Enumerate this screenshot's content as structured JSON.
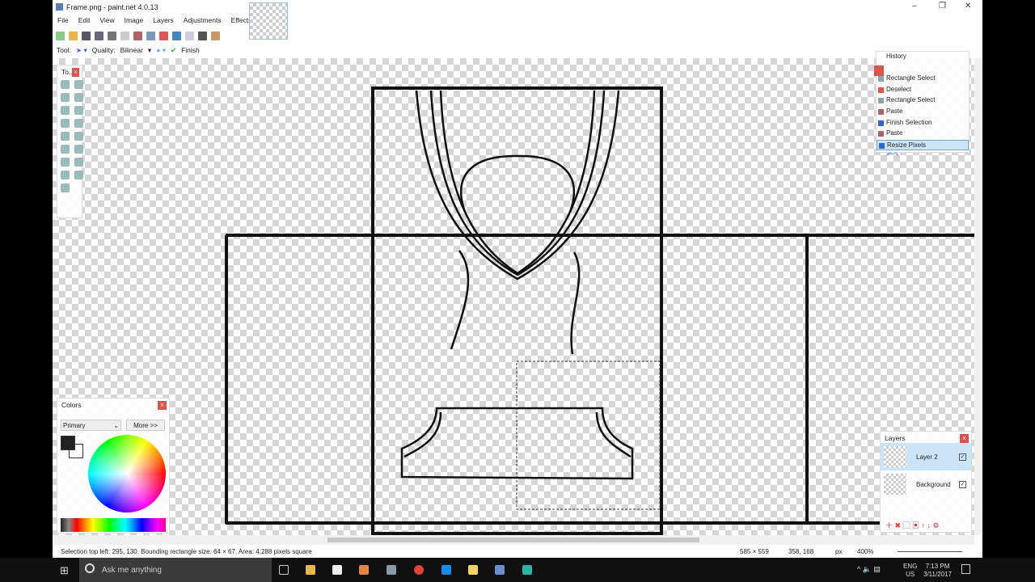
{
  "window": {
    "title": "Frame.png - paint.net 4.0.13",
    "controls": [
      "–",
      "❐",
      "✕"
    ]
  },
  "menu": [
    "File",
    "Edit",
    "View",
    "Image",
    "Layers",
    "Adjustments",
    "Effects"
  ],
  "tool_options": {
    "tool_label": "Tool:",
    "quality_label": "Quality:",
    "quality_value": "Bilinear",
    "finish_label": "Finish"
  },
  "tools_panel": {
    "title": "To..."
  },
  "history": {
    "title": "History",
    "items": [
      "Rectangle Select",
      "Deselect",
      "Rectangle Select",
      "Paste",
      "Finish Selection",
      "Paste",
      "Resize Pixels"
    ],
    "selected": "Resize Pixels"
  },
  "layers": {
    "title": "Layers",
    "items": [
      {
        "name": "Layer 2",
        "visible": true,
        "selected": true
      },
      {
        "name": "Background",
        "visible": true
      }
    ]
  },
  "colors": {
    "title": "Colors",
    "mode": "Primary",
    "more_label": "More >>",
    "primary": "#222222",
    "secondary": "#ffffff"
  },
  "status": {
    "selection": "Selection top left: 295, 130. Bounding rectangle size: 64 × 67. Area: 4,288 pixels square",
    "image_size": "585 × 559",
    "cursor": "358, 168",
    "units": "px",
    "zoom": "400%"
  },
  "taskbar": {
    "search_placeholder": "Ask me anything",
    "lang": "ENG",
    "region": "US",
    "time": "7:13 PM",
    "date": "3/11/2017"
  }
}
